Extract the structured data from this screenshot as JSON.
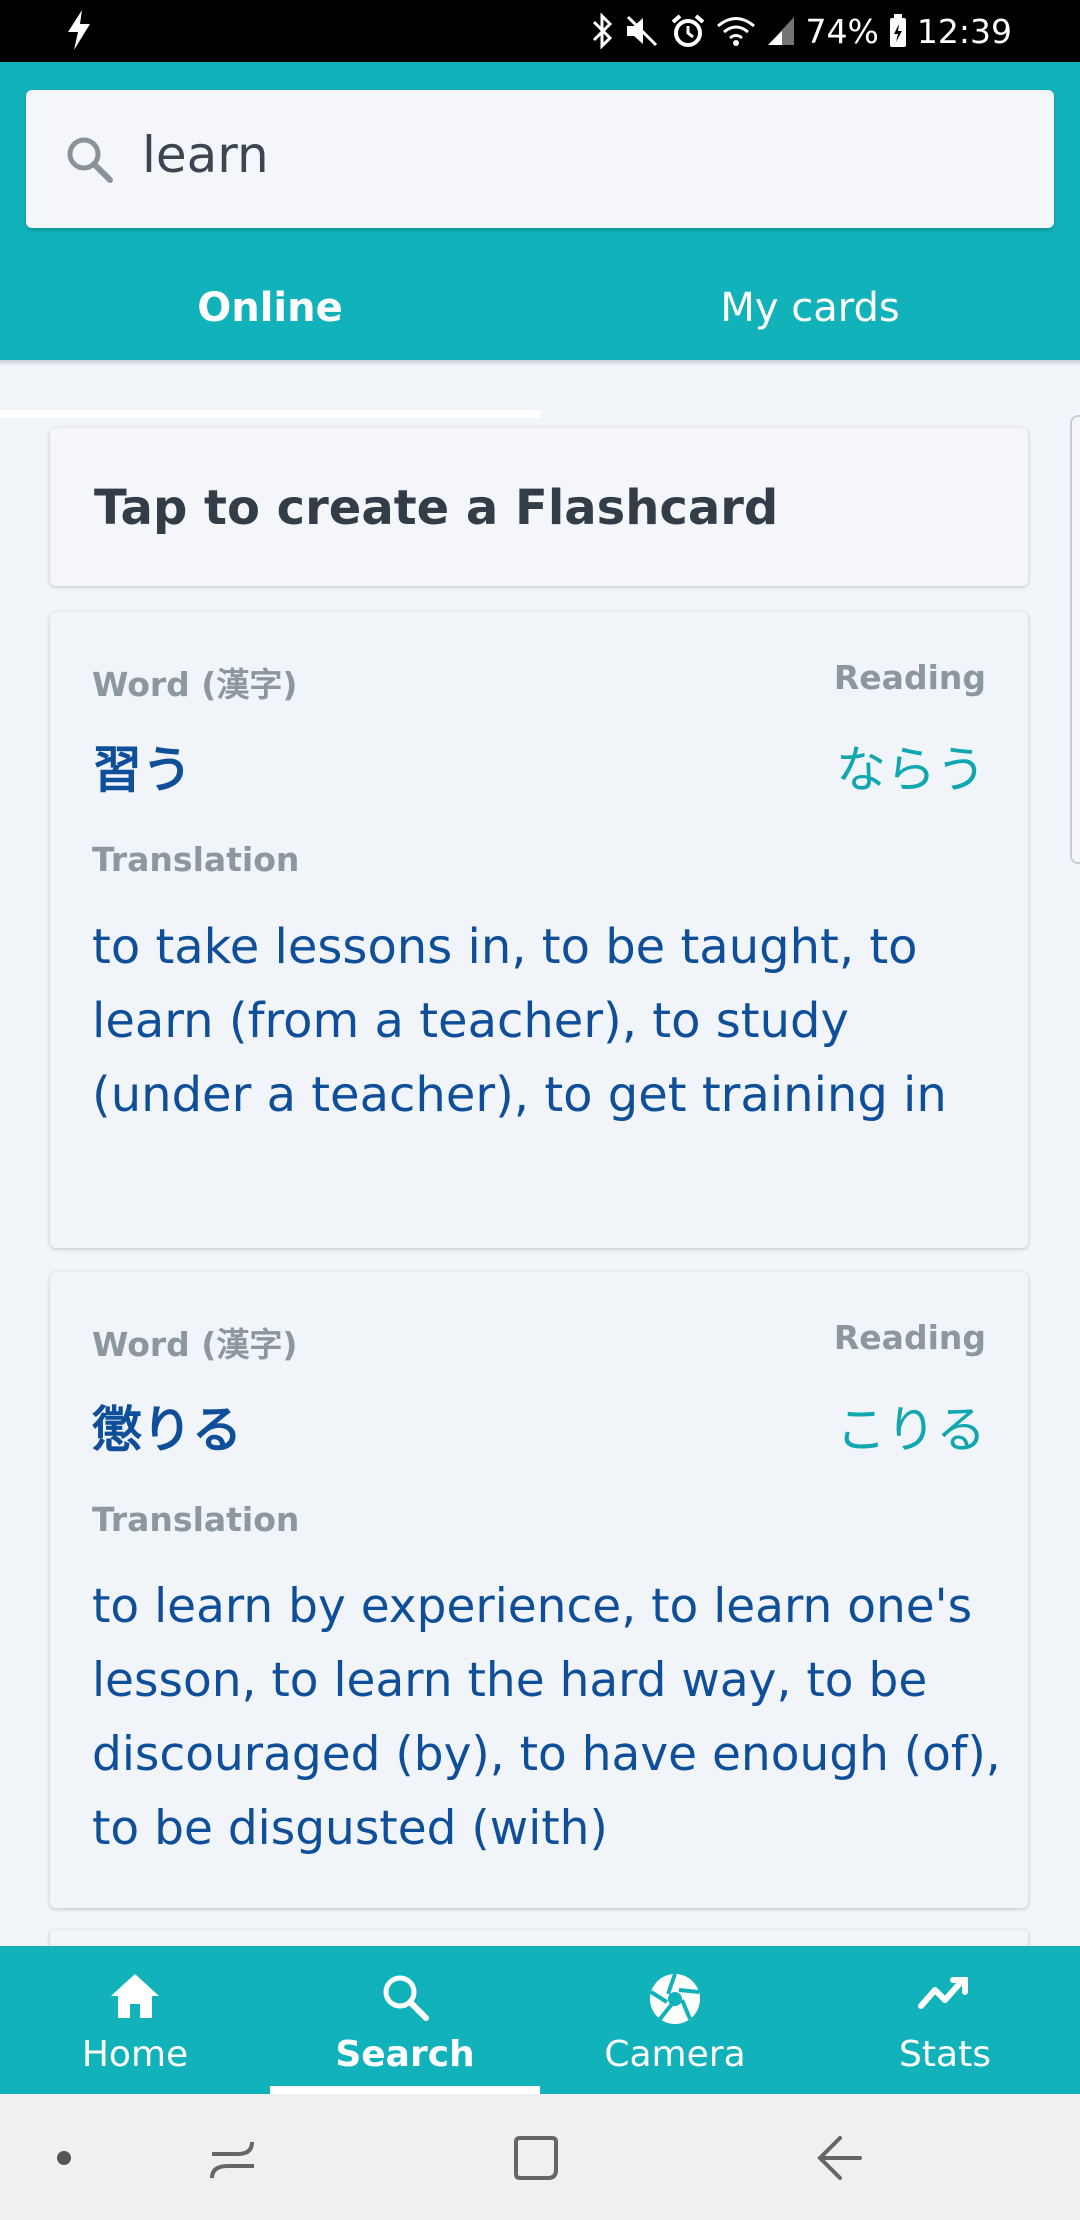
{
  "status_bar": {
    "battery": "74%",
    "time": "12:39",
    "icons": [
      "flash-icon",
      "bluetooth-icon",
      "mute-icon",
      "alarm-icon",
      "wifi-icon",
      "signal-icon",
      "battery-icon"
    ]
  },
  "search": {
    "query": "learn",
    "icon": "search-icon"
  },
  "tabs": [
    {
      "label": "Online",
      "active": true
    },
    {
      "label": "My cards",
      "active": false
    }
  ],
  "create_card": {
    "label": "Tap to create a Flashcard"
  },
  "results": [
    {
      "word_label": "Word (漢字)",
      "reading_label": "Reading",
      "word": "習う",
      "reading": "ならう",
      "translation_label": "Translation",
      "translation": "to take lessons in, to be taught, to learn (from a teacher), to study (under a teacher), to get training in"
    },
    {
      "word_label": "Word (漢字)",
      "reading_label": "Reading",
      "word": "懲りる",
      "reading": "こりる",
      "translation_label": "Translation",
      "translation": "to learn by experience, to learn one's lesson, to learn the hard way, to be discouraged (by), to have enough (of), to be disgusted (with)"
    }
  ],
  "bottom_nav": [
    {
      "label": "Home",
      "icon": "home-icon",
      "active": false
    },
    {
      "label": "Search",
      "icon": "search-icon",
      "active": true
    },
    {
      "label": "Camera",
      "icon": "camera-shutter-icon",
      "active": false
    },
    {
      "label": "Stats",
      "icon": "stats-icon",
      "active": false
    }
  ],
  "colors": {
    "accent": "#12b2bb",
    "word_text": "#0f4f9a",
    "reading_text": "#10a7b0",
    "background": "#f2f5f9"
  }
}
